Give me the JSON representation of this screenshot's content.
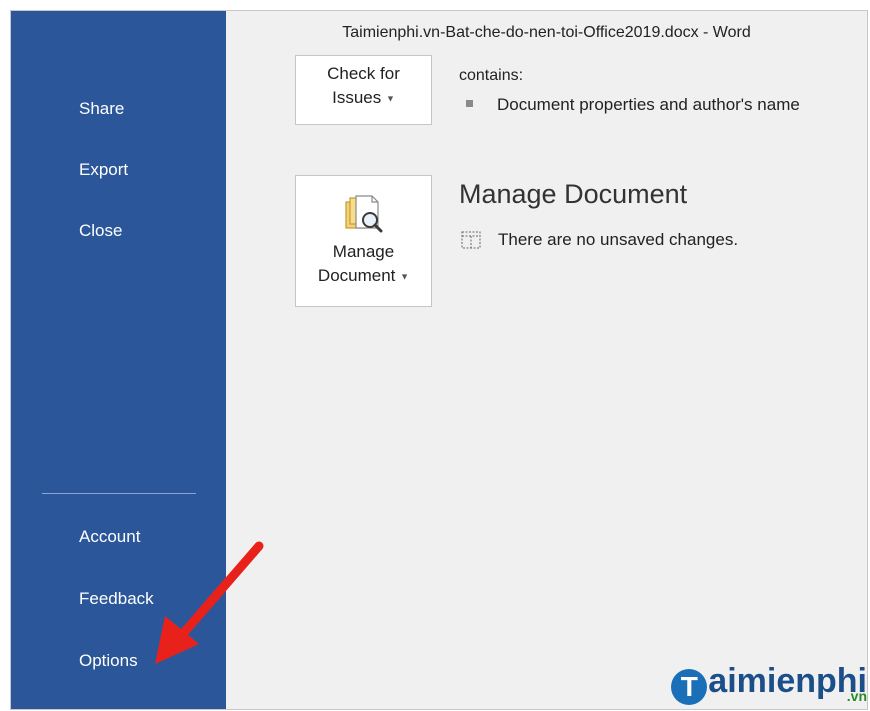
{
  "window": {
    "title": "Taimienphi.vn-Bat-che-do-nen-toi-Office2019.docx  -  Word"
  },
  "sidebar": {
    "top_items": [
      {
        "label": "Share"
      },
      {
        "label": "Export"
      },
      {
        "label": "Close"
      }
    ],
    "bottom_items": [
      {
        "label": "Account"
      },
      {
        "label": "Feedback"
      },
      {
        "label": "Options"
      }
    ],
    "background_color": "#2b579a"
  },
  "inspect": {
    "button_line1": "Check for",
    "button_line2": "Issues",
    "contains_text": "contains:",
    "bullet_text": "Document properties and author's name"
  },
  "manage": {
    "heading": "Manage Document",
    "button_line1": "Manage",
    "button_line2": "Document",
    "status_text": "There are no unsaved changes."
  },
  "watermark": {
    "text": "aimienphi",
    "letter": "T",
    "suffix": ".vn"
  },
  "annotation": {
    "arrow_color": "#e8221a"
  }
}
